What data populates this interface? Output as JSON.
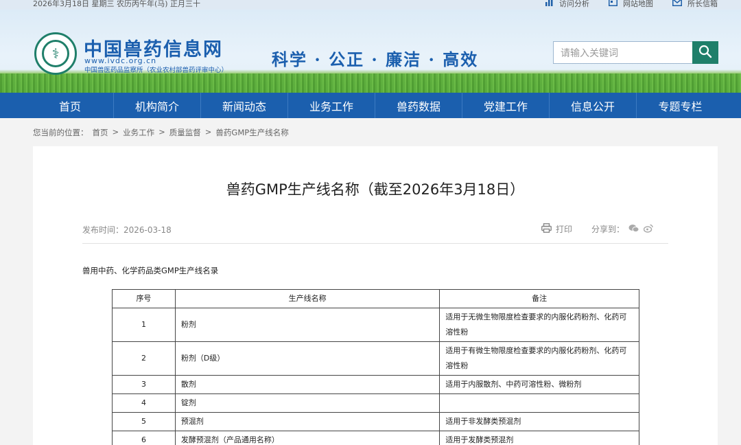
{
  "topbar": {
    "date": "2026年3月18日 星期三 农历丙午年(马) 正月三十",
    "links": [
      "访问分析",
      "网站地图",
      "所长信箱"
    ]
  },
  "header": {
    "title": "中国兽药信息网",
    "url": "www.ivdc.org.cn",
    "org": "中国兽医药品监察所（农业农村部兽药评审中心）",
    "slogan": "科学 · 公正 · 廉洁 · 高效",
    "search_placeholder": "请输入关键词",
    "icons": {
      "search": "search-icon",
      "logo": "emblem-logo"
    },
    "colors": {
      "brand": "#1b5fae",
      "accent": "#1f7f6a"
    }
  },
  "nav": [
    "首页",
    "机构简介",
    "新闻动态",
    "业务工作",
    "兽药数据",
    "党建工作",
    "信息公开",
    "专题专栏"
  ],
  "breadcrumb": {
    "prefix": "您当前的位置：",
    "items": [
      "首页",
      "业务工作",
      "质量监督",
      "兽药GMP生产线名称"
    ],
    "separator": ">"
  },
  "article": {
    "title": "兽药GMP生产线名称（截至2026年3月18日）",
    "publish_label": "发布时间：",
    "publish_date": "2026-03-18",
    "print_label": "打印",
    "share_label": "分享到：",
    "intro": "兽用中药、化学药品类GMP生产线名录",
    "table": {
      "headers": [
        "序号",
        "生产线名称",
        "备注"
      ],
      "rows": [
        {
          "no": "1",
          "name": "粉剂",
          "note": "适用于无微生物限度检查要求的内服化药粉剂、化药可溶性粉"
        },
        {
          "no": "2",
          "name": "粉剂（D级）",
          "note": "适用于有微生物限度检查要求的内服化药粉剂、化药可溶性粉"
        },
        {
          "no": "3",
          "name": "散剂",
          "note": "适用于内服散剂、中药可溶性粉、微粉剂"
        },
        {
          "no": "4",
          "name": "锭剂",
          "note": ""
        },
        {
          "no": "5",
          "name": "预混剂",
          "note": "适用于非发酵类预混剂"
        },
        {
          "no": "6",
          "name": "发酵预混剂（产品通用名称）",
          "note": "适用于发酵类预混剂"
        }
      ]
    }
  }
}
